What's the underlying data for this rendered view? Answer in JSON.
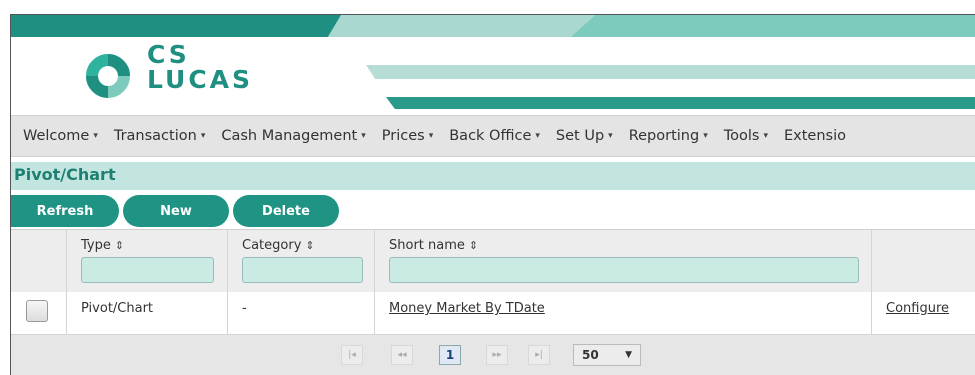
{
  "brand": {
    "logo_line1": "CS",
    "logo_line2": "LUCAS",
    "accent": "#1f8f82",
    "light": "#c2e6df"
  },
  "menu": {
    "items": [
      {
        "label": "Welcome"
      },
      {
        "label": "Transaction"
      },
      {
        "label": "Cash Management"
      },
      {
        "label": "Prices"
      },
      {
        "label": "Back Office"
      },
      {
        "label": "Set Up"
      },
      {
        "label": "Reporting"
      },
      {
        "label": "Tools"
      },
      {
        "label": "Extensio"
      }
    ],
    "caret": "▾"
  },
  "page": {
    "title": "Pivot/Chart"
  },
  "toolbar": {
    "refresh": "Refresh",
    "new": "New",
    "delete": "Delete"
  },
  "grid": {
    "columns": {
      "type": "Type",
      "category": "Category",
      "short_name": "Short name"
    },
    "sort_icon": "⇕",
    "rows": [
      {
        "type": "Pivot/Chart",
        "category": "-",
        "short_name": "Money Market By TDate",
        "action": "Configure"
      }
    ]
  },
  "pager": {
    "first": "|◂",
    "prev": "◂◂",
    "current_page": "1",
    "next": "▸▸",
    "last": "▸|",
    "page_size": "50",
    "page_size_caret": "▼"
  }
}
